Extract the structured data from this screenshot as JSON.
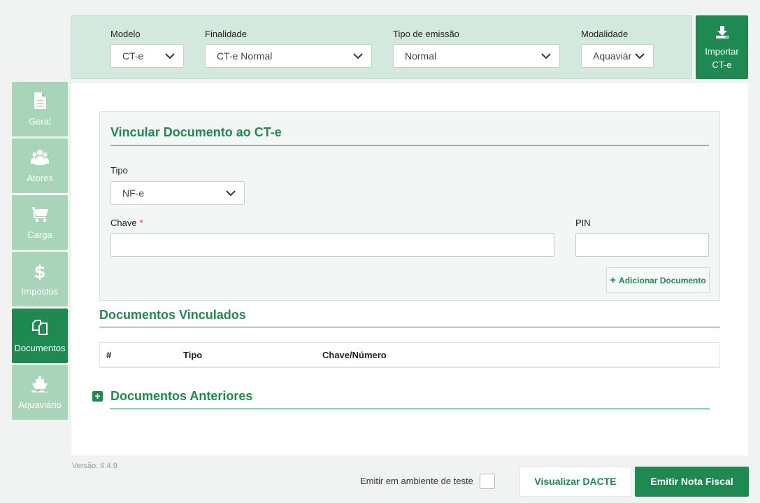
{
  "filters": {
    "modelo": {
      "label": "Modelo",
      "value": "CT-e"
    },
    "finalidade": {
      "label": "Finalidade",
      "value": "CT-e Normal"
    },
    "tipo_emissao": {
      "label": "Tipo de emissão",
      "value": "Normal"
    },
    "modalidade": {
      "label": "Modalidade",
      "value": "Aquaviário"
    }
  },
  "import_button": {
    "line1": "Importar",
    "line2": "CT-e",
    "icon": "download-icon"
  },
  "sidebar": {
    "items": [
      {
        "label": "Geral",
        "icon": "document-icon",
        "active": false
      },
      {
        "label": "Atores",
        "icon": "users-icon",
        "active": false
      },
      {
        "label": "Carga",
        "icon": "cart-icon",
        "active": false
      },
      {
        "label": "Impostos",
        "icon": "dollar-icon",
        "active": false
      },
      {
        "label": "Documentos",
        "icon": "copy-icon",
        "active": true
      },
      {
        "label": "Aquaviário",
        "icon": "ship-icon",
        "active": false
      }
    ]
  },
  "vincular": {
    "title": "Vincular Documento ao CT-e",
    "tipo_label": "Tipo",
    "tipo_value": "NF-e",
    "chave_label": "Chave",
    "required_mark": "*",
    "chave_value": "",
    "pin_label": "PIN",
    "pin_value": "",
    "add_button": "Adicionar Documento",
    "add_icon": "+"
  },
  "vinculados": {
    "title": "Documentos Vinculados",
    "columns": [
      "#",
      "Tipo",
      "Chave/Número"
    ]
  },
  "anteriores": {
    "title": "Documentos Anteriores",
    "icon": "+"
  },
  "footer": {
    "version": "Versão: 6.4.9",
    "test_label": "Emitir em ambiente de teste",
    "view_button": "Visualizar DACTE",
    "emit_button": "Emitir Nota Fiscal"
  },
  "colors": {
    "accent": "#1e8a51",
    "sidebar_inactive": "#a8d5b9",
    "filter_bg": "#d4e9dd"
  }
}
